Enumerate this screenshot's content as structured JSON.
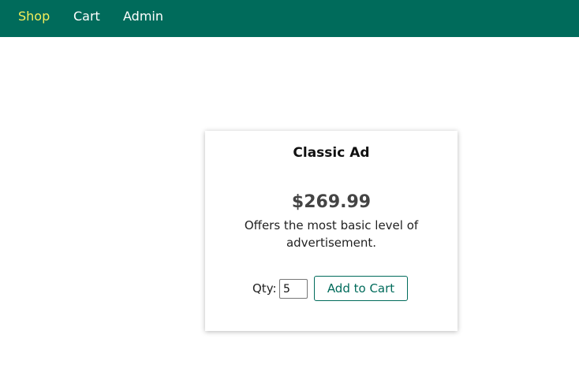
{
  "nav": {
    "items": [
      {
        "label": "Shop",
        "active": true
      },
      {
        "label": "Cart",
        "active": false
      },
      {
        "label": "Admin",
        "active": false
      }
    ]
  },
  "product": {
    "title": "Classic Ad",
    "price": "$269.99",
    "description": "Offers the most basic level of advertisement.",
    "qty_label": "Qty:",
    "qty_value": "5",
    "add_label": "Add to Cart"
  },
  "colors": {
    "nav_bg": "#006b5b",
    "nav_active": "#f4ee5a",
    "accent": "#006b5b"
  }
}
